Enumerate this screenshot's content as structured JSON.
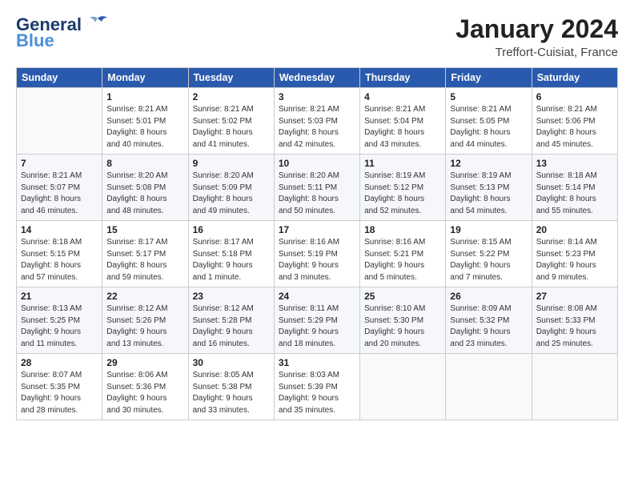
{
  "header": {
    "logo_general": "General",
    "logo_blue": "Blue",
    "month_title": "January 2024",
    "location": "Treffort-Cuisiat, France"
  },
  "weekdays": [
    "Sunday",
    "Monday",
    "Tuesday",
    "Wednesday",
    "Thursday",
    "Friday",
    "Saturday"
  ],
  "weeks": [
    [
      {
        "day": "",
        "info": ""
      },
      {
        "day": "1",
        "info": "Sunrise: 8:21 AM\nSunset: 5:01 PM\nDaylight: 8 hours\nand 40 minutes."
      },
      {
        "day": "2",
        "info": "Sunrise: 8:21 AM\nSunset: 5:02 PM\nDaylight: 8 hours\nand 41 minutes."
      },
      {
        "day": "3",
        "info": "Sunrise: 8:21 AM\nSunset: 5:03 PM\nDaylight: 8 hours\nand 42 minutes."
      },
      {
        "day": "4",
        "info": "Sunrise: 8:21 AM\nSunset: 5:04 PM\nDaylight: 8 hours\nand 43 minutes."
      },
      {
        "day": "5",
        "info": "Sunrise: 8:21 AM\nSunset: 5:05 PM\nDaylight: 8 hours\nand 44 minutes."
      },
      {
        "day": "6",
        "info": "Sunrise: 8:21 AM\nSunset: 5:06 PM\nDaylight: 8 hours\nand 45 minutes."
      }
    ],
    [
      {
        "day": "7",
        "info": "Sunrise: 8:21 AM\nSunset: 5:07 PM\nDaylight: 8 hours\nand 46 minutes."
      },
      {
        "day": "8",
        "info": "Sunrise: 8:20 AM\nSunset: 5:08 PM\nDaylight: 8 hours\nand 48 minutes."
      },
      {
        "day": "9",
        "info": "Sunrise: 8:20 AM\nSunset: 5:09 PM\nDaylight: 8 hours\nand 49 minutes."
      },
      {
        "day": "10",
        "info": "Sunrise: 8:20 AM\nSunset: 5:11 PM\nDaylight: 8 hours\nand 50 minutes."
      },
      {
        "day": "11",
        "info": "Sunrise: 8:19 AM\nSunset: 5:12 PM\nDaylight: 8 hours\nand 52 minutes."
      },
      {
        "day": "12",
        "info": "Sunrise: 8:19 AM\nSunset: 5:13 PM\nDaylight: 8 hours\nand 54 minutes."
      },
      {
        "day": "13",
        "info": "Sunrise: 8:18 AM\nSunset: 5:14 PM\nDaylight: 8 hours\nand 55 minutes."
      }
    ],
    [
      {
        "day": "14",
        "info": "Sunrise: 8:18 AM\nSunset: 5:15 PM\nDaylight: 8 hours\nand 57 minutes."
      },
      {
        "day": "15",
        "info": "Sunrise: 8:17 AM\nSunset: 5:17 PM\nDaylight: 8 hours\nand 59 minutes."
      },
      {
        "day": "16",
        "info": "Sunrise: 8:17 AM\nSunset: 5:18 PM\nDaylight: 9 hours\nand 1 minute."
      },
      {
        "day": "17",
        "info": "Sunrise: 8:16 AM\nSunset: 5:19 PM\nDaylight: 9 hours\nand 3 minutes."
      },
      {
        "day": "18",
        "info": "Sunrise: 8:16 AM\nSunset: 5:21 PM\nDaylight: 9 hours\nand 5 minutes."
      },
      {
        "day": "19",
        "info": "Sunrise: 8:15 AM\nSunset: 5:22 PM\nDaylight: 9 hours\nand 7 minutes."
      },
      {
        "day": "20",
        "info": "Sunrise: 8:14 AM\nSunset: 5:23 PM\nDaylight: 9 hours\nand 9 minutes."
      }
    ],
    [
      {
        "day": "21",
        "info": "Sunrise: 8:13 AM\nSunset: 5:25 PM\nDaylight: 9 hours\nand 11 minutes."
      },
      {
        "day": "22",
        "info": "Sunrise: 8:12 AM\nSunset: 5:26 PM\nDaylight: 9 hours\nand 13 minutes."
      },
      {
        "day": "23",
        "info": "Sunrise: 8:12 AM\nSunset: 5:28 PM\nDaylight: 9 hours\nand 16 minutes."
      },
      {
        "day": "24",
        "info": "Sunrise: 8:11 AM\nSunset: 5:29 PM\nDaylight: 9 hours\nand 18 minutes."
      },
      {
        "day": "25",
        "info": "Sunrise: 8:10 AM\nSunset: 5:30 PM\nDaylight: 9 hours\nand 20 minutes."
      },
      {
        "day": "26",
        "info": "Sunrise: 8:09 AM\nSunset: 5:32 PM\nDaylight: 9 hours\nand 23 minutes."
      },
      {
        "day": "27",
        "info": "Sunrise: 8:08 AM\nSunset: 5:33 PM\nDaylight: 9 hours\nand 25 minutes."
      }
    ],
    [
      {
        "day": "28",
        "info": "Sunrise: 8:07 AM\nSunset: 5:35 PM\nDaylight: 9 hours\nand 28 minutes."
      },
      {
        "day": "29",
        "info": "Sunrise: 8:06 AM\nSunset: 5:36 PM\nDaylight: 9 hours\nand 30 minutes."
      },
      {
        "day": "30",
        "info": "Sunrise: 8:05 AM\nSunset: 5:38 PM\nDaylight: 9 hours\nand 33 minutes."
      },
      {
        "day": "31",
        "info": "Sunrise: 8:03 AM\nSunset: 5:39 PM\nDaylight: 9 hours\nand 35 minutes."
      },
      {
        "day": "",
        "info": ""
      },
      {
        "day": "",
        "info": ""
      },
      {
        "day": "",
        "info": ""
      }
    ]
  ]
}
